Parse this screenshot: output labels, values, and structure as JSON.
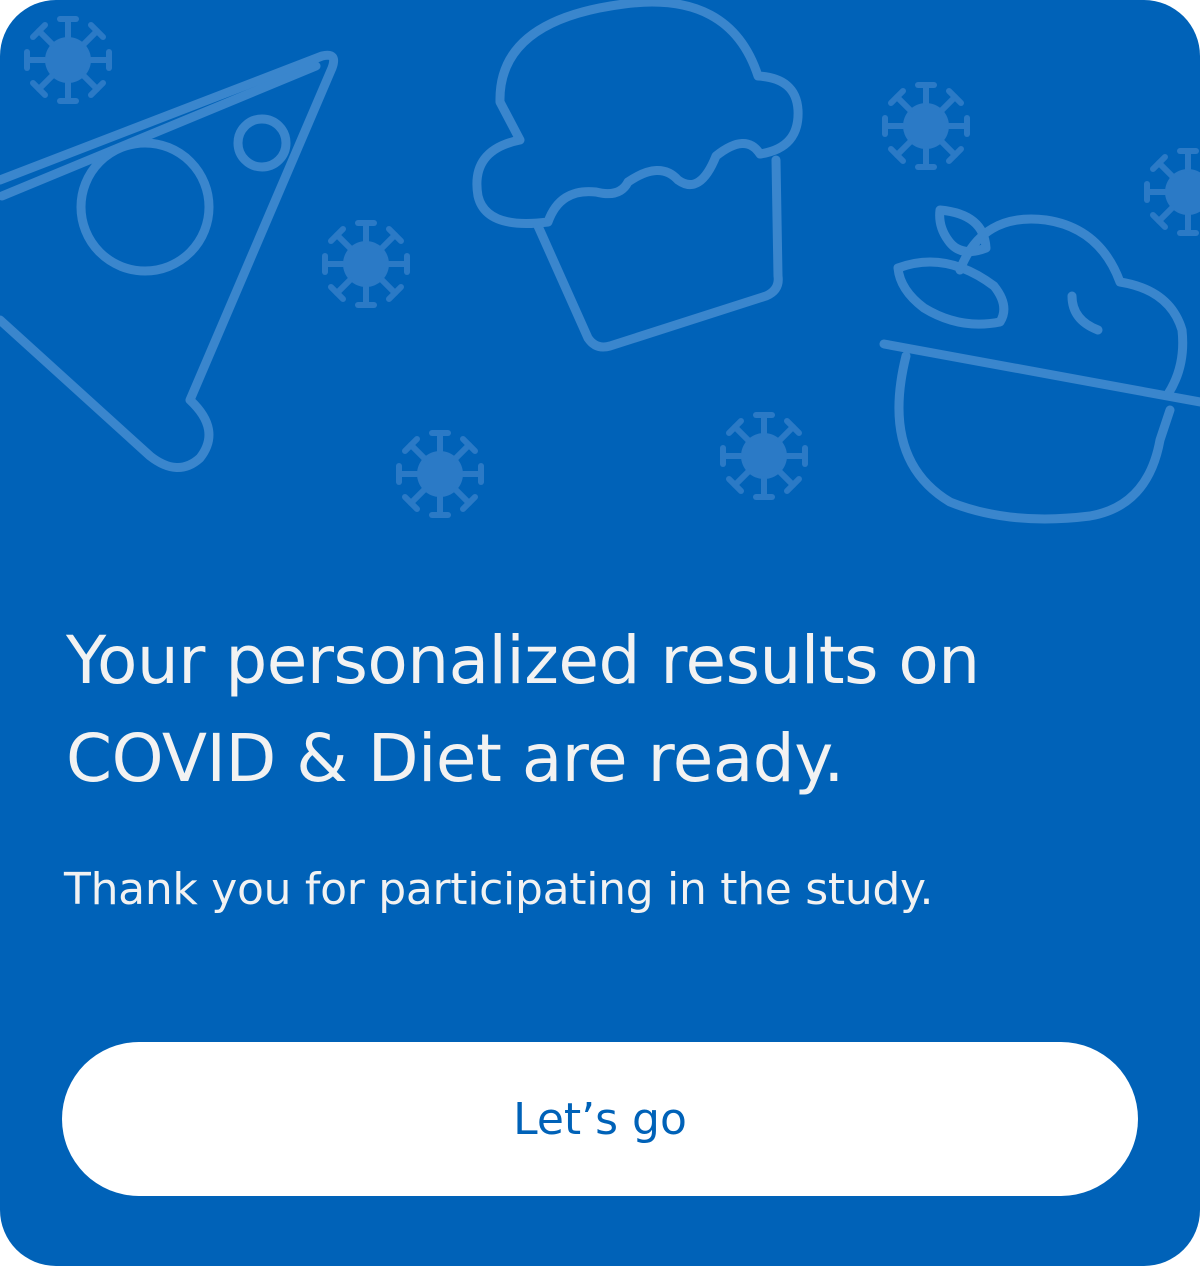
{
  "theme": {
    "card_background": "#0062B8",
    "illustration_stroke": "#3A86CD",
    "virus_fill": "#2B7AC6",
    "text_color": "#F2F2F2",
    "button_background": "#FFFFFF",
    "button_text": "#0062B8"
  },
  "illustration": {
    "icons": [
      "pizza-slice-icon",
      "cupcake-icon",
      "fruit-bowl-icon",
      "virus-icon"
    ]
  },
  "headline": "Your personalized results on\nCOVID & Diet are ready.",
  "subtitle": "Thank you for participating in the study.",
  "cta": {
    "label": "Let’s go"
  }
}
